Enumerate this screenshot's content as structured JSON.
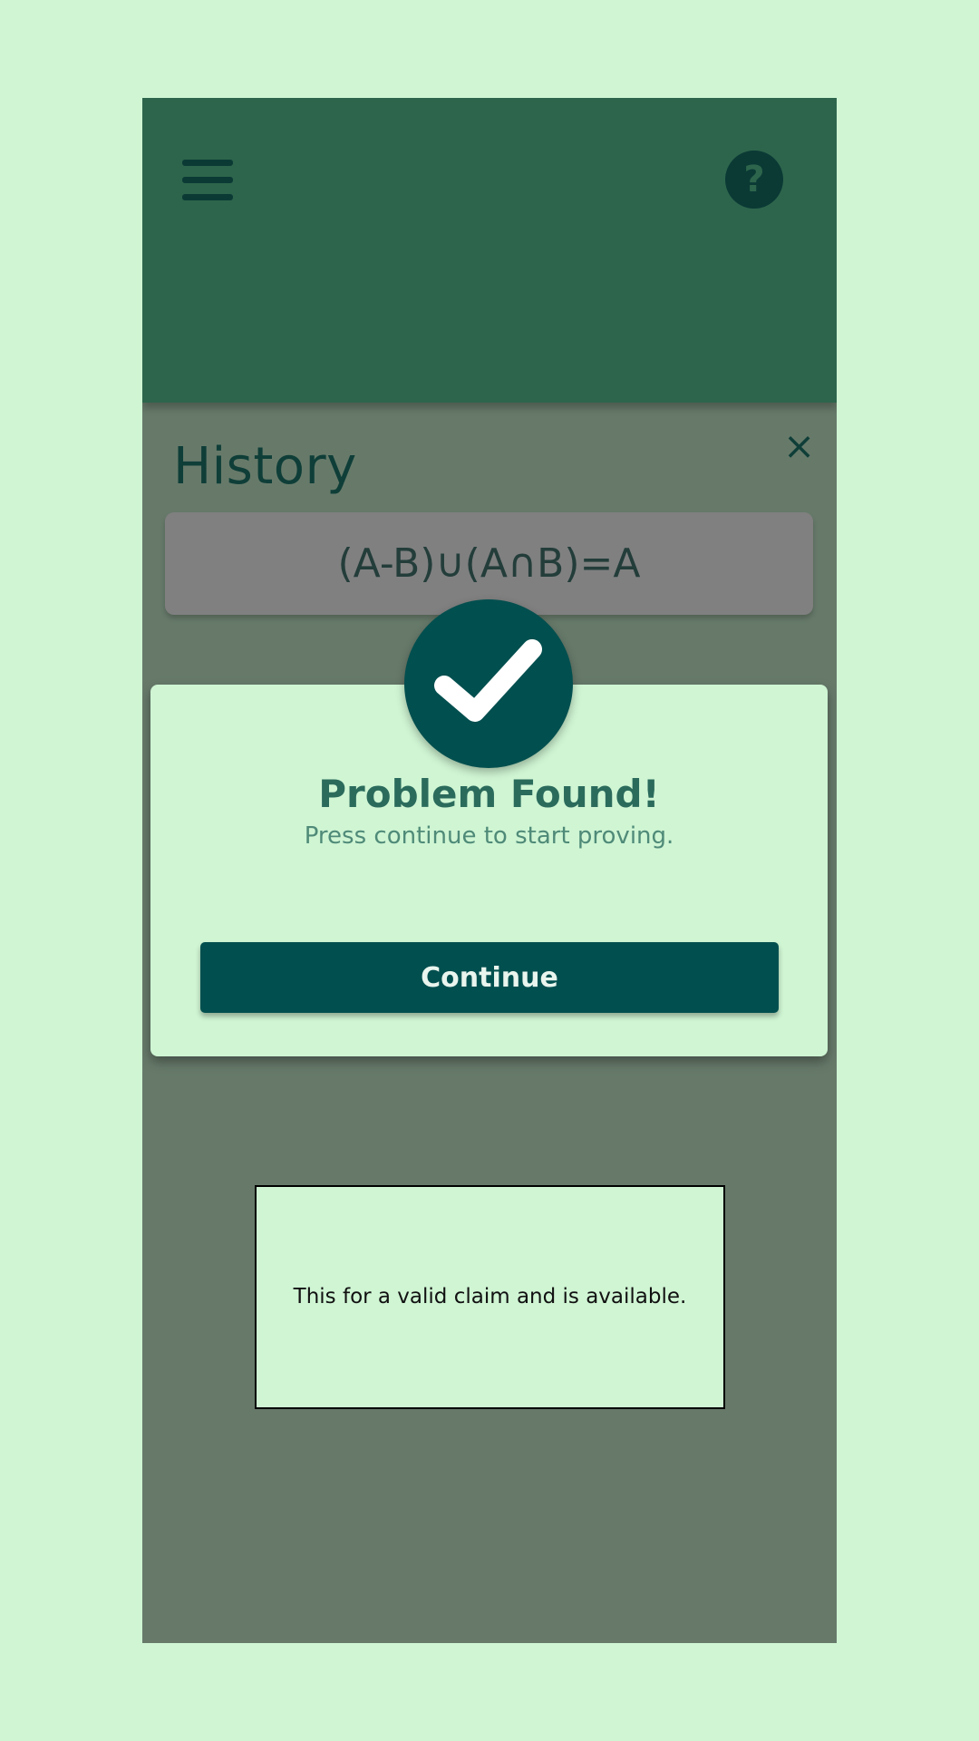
{
  "header": {
    "menu_icon": "hamburger-menu-icon",
    "help_icon": "question-mark-icon",
    "help_glyph": "?",
    "color": "#2d654c"
  },
  "history": {
    "title": "History",
    "close_glyph": "×",
    "items": [
      {
        "expression": "(A-B)∪(A∩B)=A"
      }
    ]
  },
  "dialog": {
    "icon": "checkmark-icon",
    "title": "Problem Found!",
    "subtitle": "Press continue to start proving.",
    "continue_label": "Continue",
    "accent_color": "#024f4f"
  },
  "tooltip": {
    "text": "This for a valid claim and is available."
  },
  "colors": {
    "background": "#cff5d3",
    "overlay": "#677a6a",
    "dark_teal": "#024f4f"
  }
}
